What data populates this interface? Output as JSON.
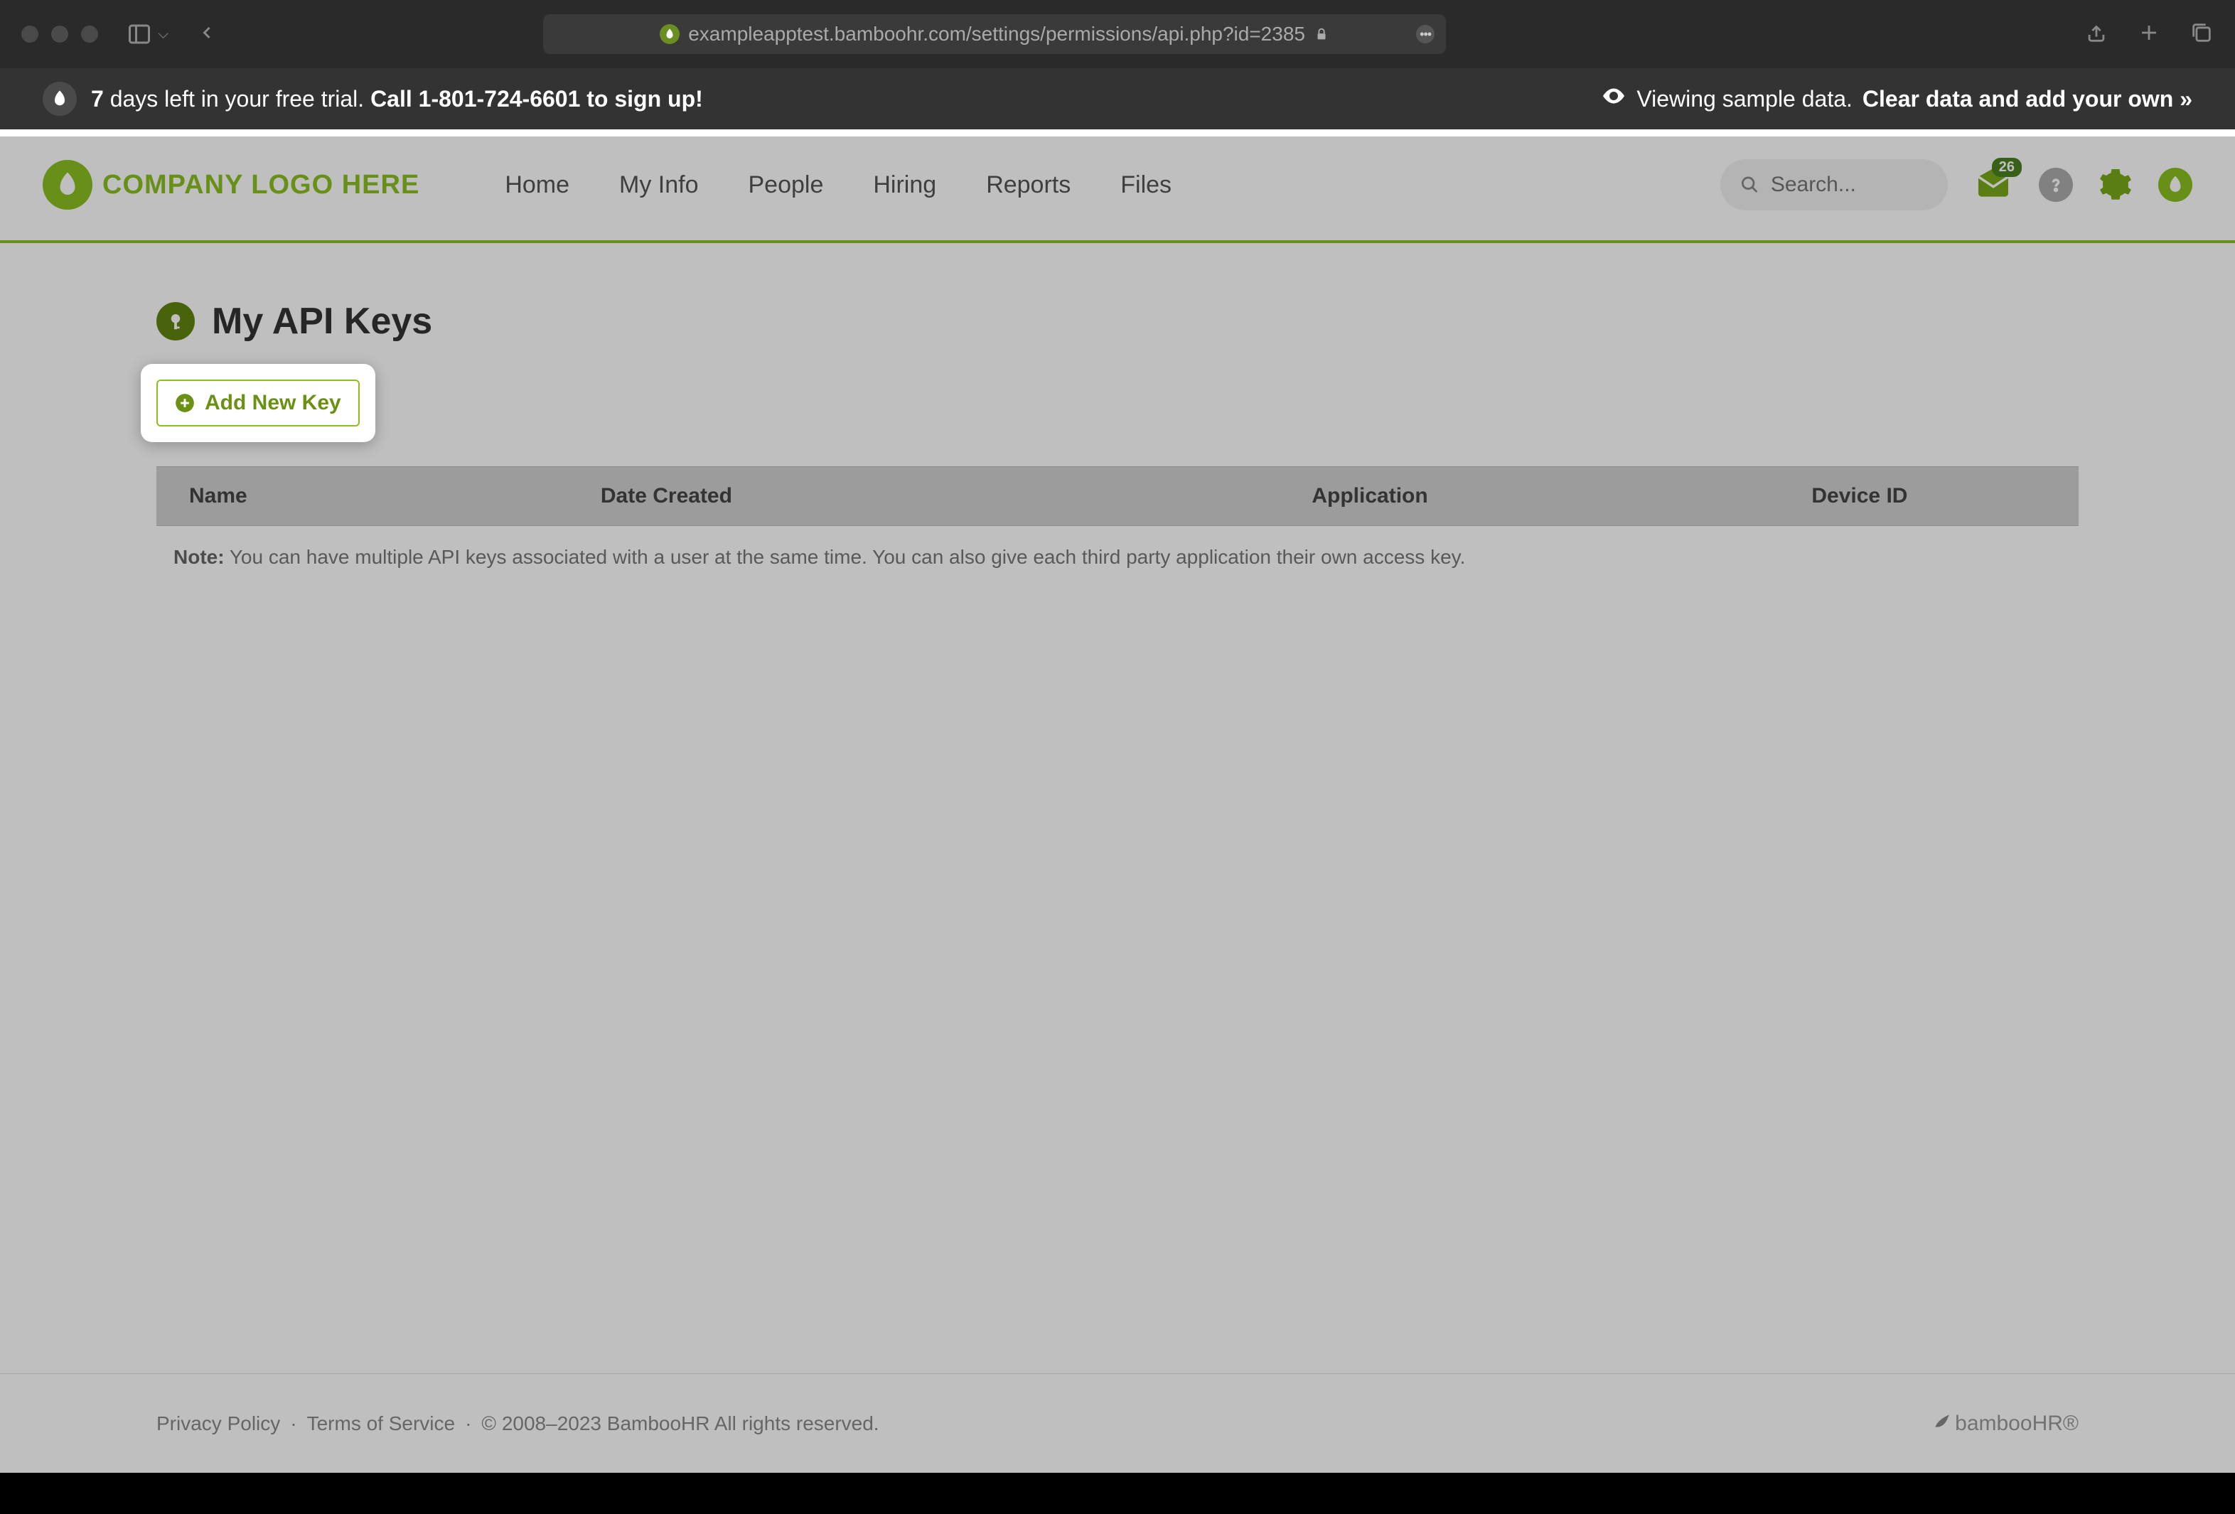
{
  "browser": {
    "url": "exampleapptest.bamboohr.com/settings/permissions/api.php?id=2385"
  },
  "trial_banner": {
    "days_left_text": "7",
    "trial_text": " days left in your free trial. ",
    "call_text": "Call 1-801-724-6601 to sign up!",
    "sample_text": "Viewing sample data. ",
    "clear_link": "Clear data and add your own »"
  },
  "header": {
    "logo_text": "COMPANY LOGO HERE",
    "nav": [
      "Home",
      "My Info",
      "People",
      "Hiring",
      "Reports",
      "Files"
    ],
    "search_placeholder": "Search...",
    "inbox_badge": "26"
  },
  "page": {
    "title": "My API Keys",
    "add_button": "Add New Key",
    "table_headers": [
      "Name",
      "Date Created",
      "Application",
      "Device ID"
    ],
    "note_label": "Note:",
    "note_text": " You can have multiple API keys associated with a user at the same time. You can also give each third party application their own access key."
  },
  "footer": {
    "privacy": "Privacy Policy",
    "terms": "Terms of Service",
    "copyright": "© 2008–2023 BambooHR All rights reserved.",
    "brand": "bamboo",
    "brand_suffix": "HR®"
  }
}
